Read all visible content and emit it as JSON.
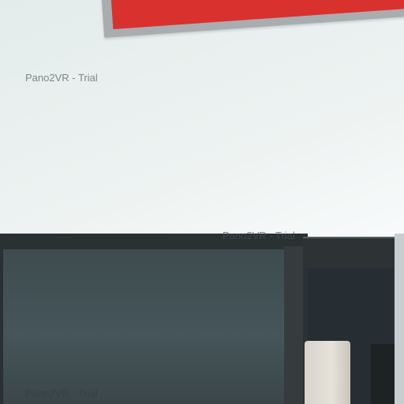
{
  "watermarks": [
    "Pano2VR - Trial",
    "Pano2VR - Trial",
    "Pano2VR - Trial"
  ],
  "colors": {
    "wall": "#eef3f2",
    "frame_border": "#a9adaf",
    "poster_red": "#d9312e",
    "monitor_body": "#2a3133",
    "monitor_screen": "#45555a"
  }
}
